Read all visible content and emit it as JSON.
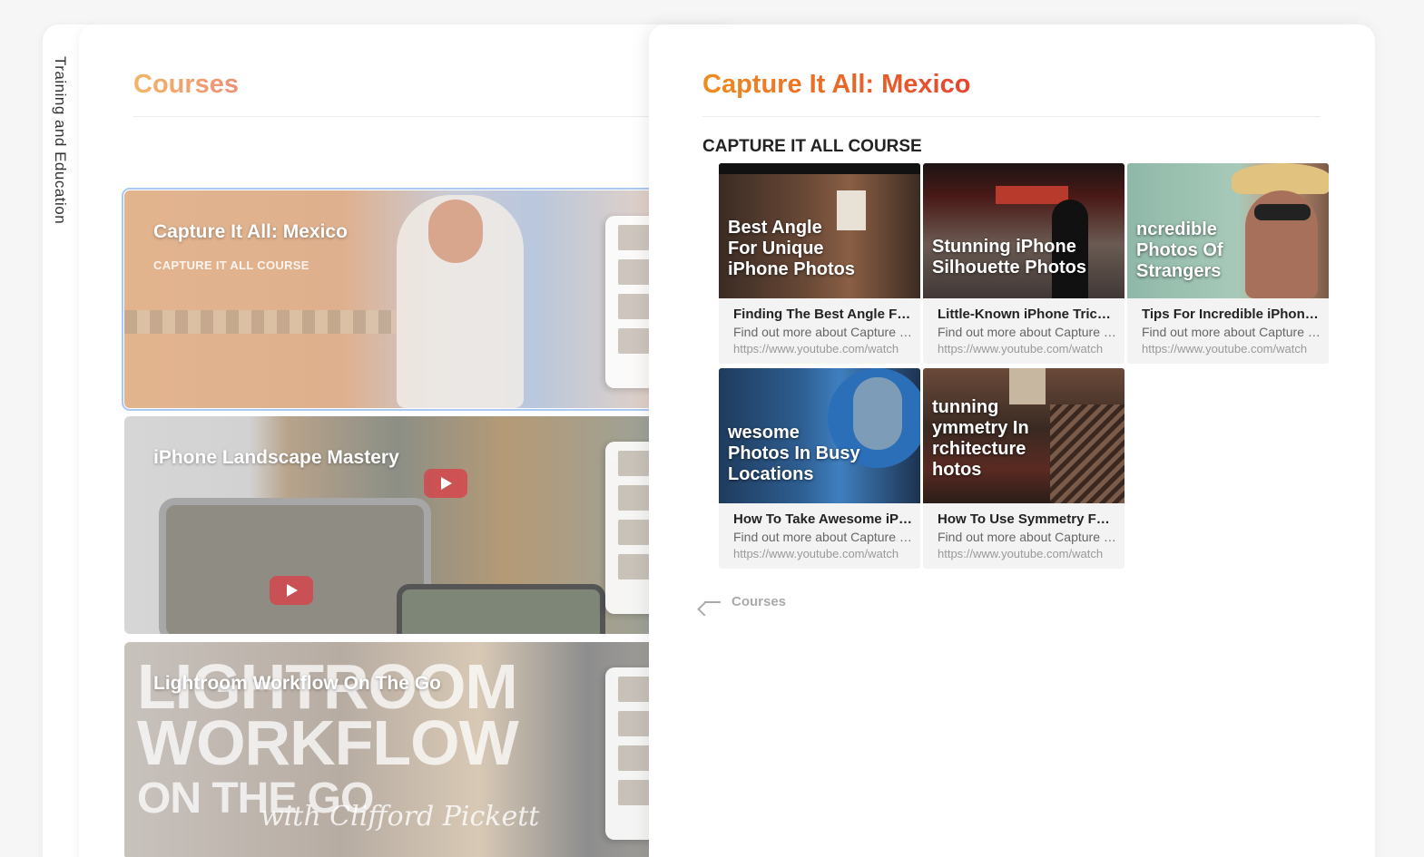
{
  "sidebar": {
    "label": "Training and Education"
  },
  "courses_panel": {
    "title": "Courses",
    "cards": [
      {
        "title": "Capture It All:  Mexico",
        "subtitle": "CAPTURE IT ALL COURSE"
      },
      {
        "title": "iPhone Landscape Mastery"
      },
      {
        "title": "Lightroom Workflow On The Go"
      }
    ],
    "lightroom_graphic": {
      "lines": [
        "LIGHTROOM",
        "WORKFLOW",
        "ON THE GO"
      ],
      "signature": "with Clifford Pickett"
    }
  },
  "detail_panel": {
    "title": "Capture It All: Mexico",
    "section_label": "CAPTURE IT ALL COURSE",
    "videos": [
      {
        "thumb_caption": "Best Angle\nFor Unique\niPhone Photos",
        "title": "Finding The Best Angle For Unique iPhone Photos",
        "description": "Find out more about Capture It All",
        "url": "https://www.youtube.com/watch"
      },
      {
        "thumb_caption": "Stunning iPhone\nSilhouette Photos",
        "title": "Little-Known iPhone Trick For Stunning Silhouettes",
        "description": "Find out more about Capture It All",
        "url": "https://www.youtube.com/watch"
      },
      {
        "thumb_caption": "ncredible\nPhotos Of\nStrangers",
        "title": "Tips For Incredible iPhone Photos Of Strangers",
        "description": "Find out more about Capture It All",
        "url": "https://www.youtube.com/watch"
      },
      {
        "thumb_caption": "wesome\nPhotos In Busy\nLocations",
        "title": "How To Take Awesome iPhone Photos In Busy Locations",
        "description": "Find out more about Capture It All",
        "url": "https://www.youtube.com/watch"
      },
      {
        "thumb_caption": "tunning\nymmetry In\nrchitecture\nhotos",
        "title": "How To Use Symmetry For Stunning Architecture Photos",
        "description": "Find out more about Capture It All",
        "url": "https://www.youtube.com/watch"
      }
    ],
    "back_link": "Courses"
  }
}
